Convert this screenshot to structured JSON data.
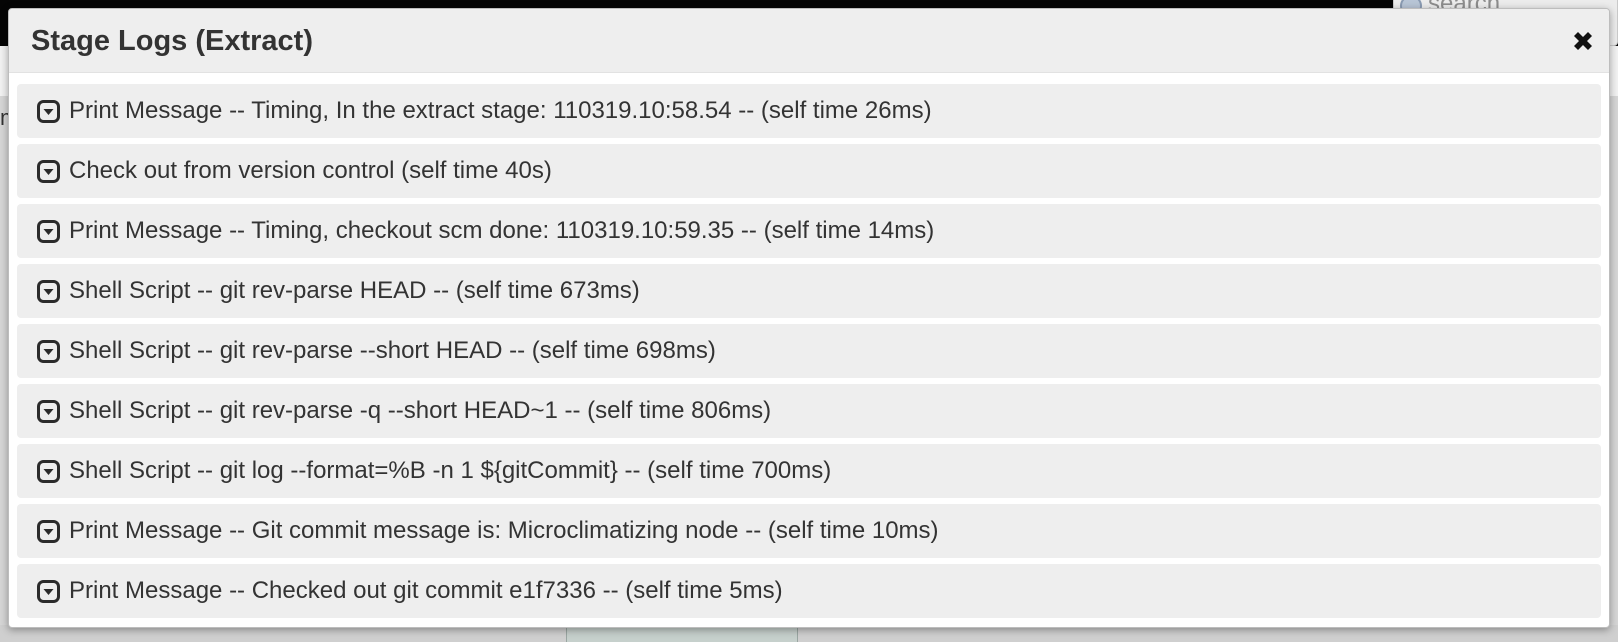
{
  "background": {
    "search_placeholder": "search",
    "left_fragment": "m"
  },
  "modal": {
    "title": "Stage Logs (Extract)",
    "close_symbol": "✖"
  },
  "logs": [
    {
      "icon": "chevron-down-square-icon",
      "text": "Print Message -- Timing, In the extract stage: 110319.10:58.54 -- (self time 26ms)"
    },
    {
      "icon": "chevron-down-square-icon",
      "text": "Check out from version control (self time 40s)"
    },
    {
      "icon": "chevron-down-square-icon",
      "text": "Print Message -- Timing, checkout scm done: 110319.10:59.35 -- (self time 14ms)"
    },
    {
      "icon": "chevron-down-square-icon",
      "text": "Shell Script -- git rev-parse HEAD -- (self time 673ms)"
    },
    {
      "icon": "chevron-down-square-icon",
      "text": "Shell Script -- git rev-parse --short HEAD -- (self time 698ms)"
    },
    {
      "icon": "chevron-down-square-icon",
      "text": "Shell Script -- git rev-parse -q --short HEAD~1 -- (self time 806ms)"
    },
    {
      "icon": "chevron-down-square-icon",
      "text": "Shell Script -- git log --format=%B -n 1 ${gitCommit} -- (self time 700ms)"
    },
    {
      "icon": "chevron-down-square-icon",
      "text": "Print Message -- Git commit message is: Microclimatizing node -- (self time 10ms)"
    },
    {
      "icon": "chevron-down-square-icon",
      "text": "Print Message -- Checked out git commit e1f7336 -- (self time 5ms)"
    }
  ]
}
